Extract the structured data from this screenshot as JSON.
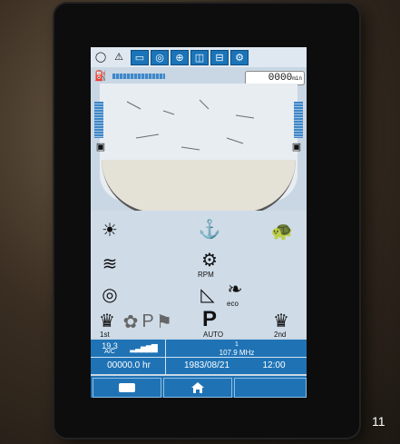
{
  "screen": {
    "top_counter": "0000",
    "top_counter_unit": "min",
    "info_left_top": "19.3",
    "info_left_mid": "A/C",
    "info_hour_meter": "00000.0",
    "info_hour_unit": "hr",
    "info_radio": "1",
    "info_radio_freq": "107.9 MHz",
    "info_date": "1983/08/21",
    "info_time": "12:00",
    "mid_labels": {
      "rpm_mode": "RPM",
      "eco": "eco",
      "gear_1st": "1st",
      "gear_2nd": "2nd",
      "auto": "AUTO"
    }
  },
  "corner_number": "11"
}
